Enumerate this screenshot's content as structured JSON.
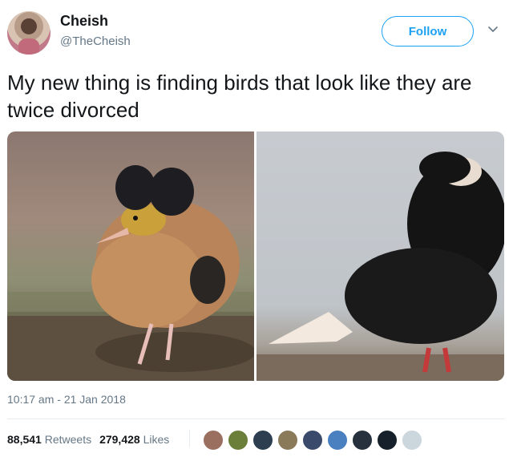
{
  "author": {
    "display_name": "Cheish",
    "handle": "@TheCheish"
  },
  "follow_button": {
    "label": "Follow"
  },
  "tweet": {
    "text": "My new thing is finding birds that look like they are twice divorced",
    "timestamp": "10:17 am - 21 Jan 2018"
  },
  "stats": {
    "retweets_count": "88,541",
    "retweets_label": "Retweets",
    "likes_count": "279,428",
    "likes_label": "Likes"
  },
  "liker_avatars": [
    {
      "color": "#9a6f5f"
    },
    {
      "color": "#6b7f3a"
    },
    {
      "color": "#2c3e50"
    },
    {
      "color": "#8a7a5a"
    },
    {
      "color": "#3a4a6a"
    },
    {
      "color": "#4a7fc0"
    },
    {
      "color": "#27313d"
    },
    {
      "color": "#15202b"
    },
    {
      "color": "#ccd6dd"
    }
  ],
  "colors": {
    "accent": "#1da1f2",
    "text_primary": "#14171a",
    "text_secondary": "#657786"
  }
}
